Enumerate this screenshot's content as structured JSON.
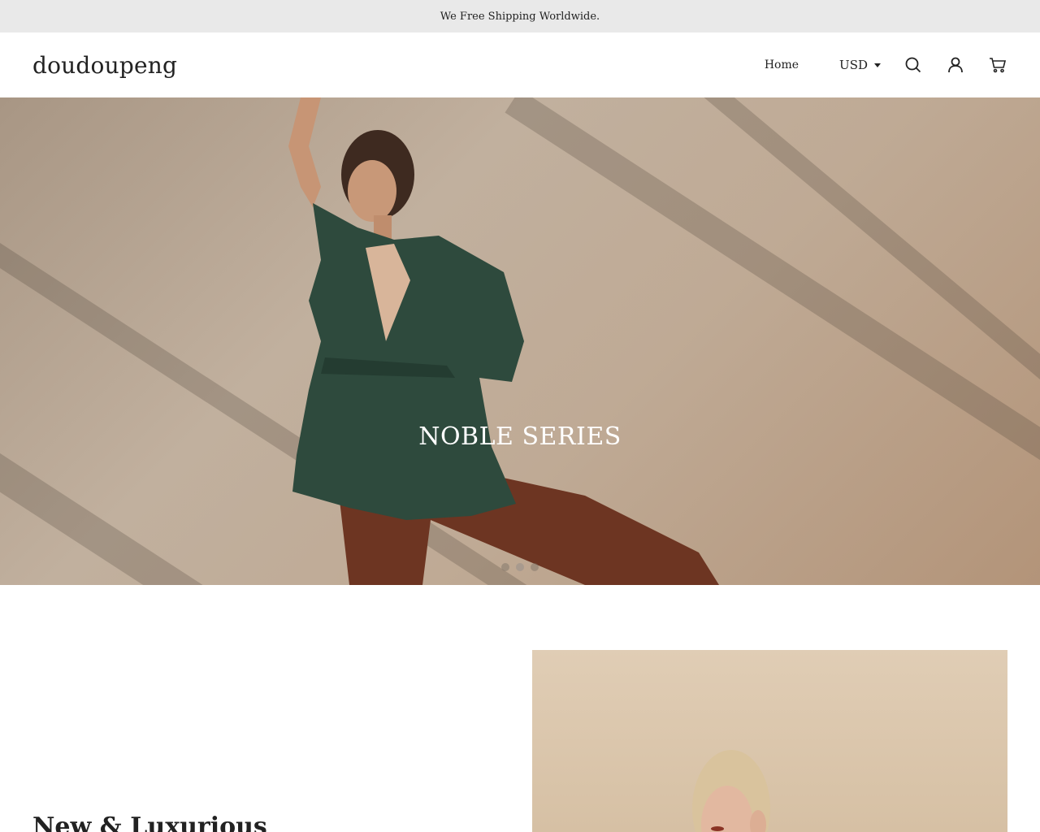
{
  "announcement": {
    "text": "We Free Shipping Worldwide."
  },
  "header": {
    "logo": "doudoupeng",
    "nav": {
      "home_label": "Home"
    },
    "currency": {
      "selected": "USD"
    },
    "icons": {
      "search": "search-icon",
      "account": "user-icon",
      "cart": "cart-icon"
    }
  },
  "hero": {
    "title": "NOBLE SERIES",
    "slide_count": 3,
    "active_slide": 2
  },
  "feature": {
    "heading": "New & Luxurious"
  },
  "colors": {
    "announcement_bg": "#e9e9e9",
    "text": "#222222",
    "hero_title": "#ffffff"
  }
}
